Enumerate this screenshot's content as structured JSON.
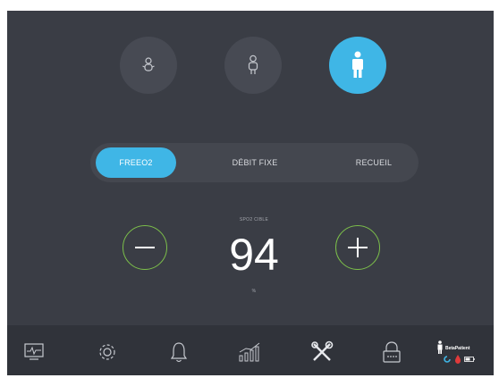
{
  "profiles": [
    {
      "icon": "baby-icon",
      "active": false
    },
    {
      "icon": "child-icon",
      "active": false
    },
    {
      "icon": "adult-icon",
      "active": true
    }
  ],
  "modes": [
    {
      "label": "FREEO2",
      "active": true
    },
    {
      "label": "DÉBIT FIXE",
      "active": false
    },
    {
      "label": "RECUEIL",
      "active": false
    }
  ],
  "target": {
    "label": "SPO2 CIBLE",
    "value": "94",
    "unit": "%"
  },
  "nav": [
    {
      "icon": "monitor-icon"
    },
    {
      "icon": "settings-gear-icon"
    },
    {
      "icon": "alarm-bell-icon"
    },
    {
      "icon": "trend-chart-icon"
    },
    {
      "icon": "tools-icon"
    },
    {
      "icon": "lock-icon"
    }
  ],
  "patient": {
    "name": "BetaPatient"
  },
  "colors": {
    "background": "#3a3d45",
    "accent": "#3fb6e6",
    "stepper_ring": "#7cbf4a",
    "bottom_bar": "#30333a"
  }
}
